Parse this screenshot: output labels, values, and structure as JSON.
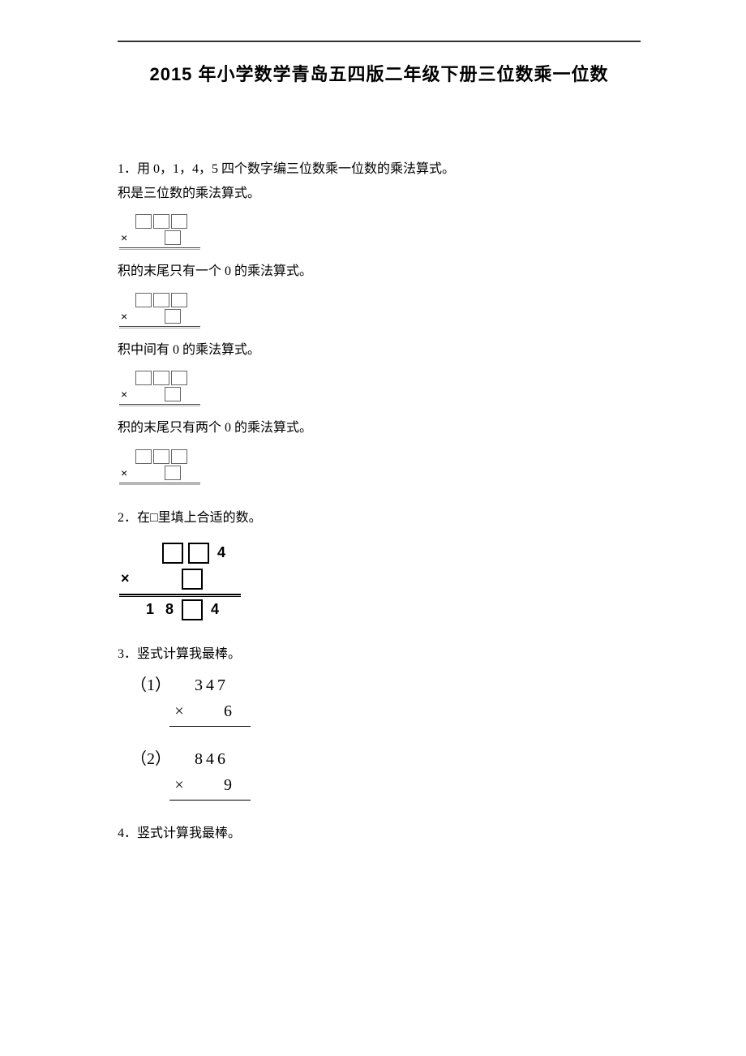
{
  "title": "2015 年小学数学青岛五四版二年级下册三位数乘一位数",
  "q1": {
    "number": "1．",
    "prompt": "用 0，1，4，5 四个数字编三位数乘一位数的乘法算式。",
    "sub1": "积是三位数的乘法算式。",
    "sub2": "积的末尾只有一个 0 的乘法算式。",
    "sub3": "积中间有 0 的乘法算式。",
    "sub4": "积的末尾只有两个 0 的乘法算式。"
  },
  "q2": {
    "number": "2．",
    "prompt": "在□里填上合适的数。",
    "top_trailing": "4",
    "times": "×",
    "result_a": "1",
    "result_b": "8",
    "result_d": "4"
  },
  "q3": {
    "number": "3．",
    "prompt": "竖式计算我最棒。",
    "items": [
      {
        "label": "（1）",
        "multiplicand": "347",
        "multiplier": "6"
      },
      {
        "label": "（2）",
        "multiplicand": "846",
        "multiplier": "9"
      }
    ],
    "times": "×"
  },
  "q4": {
    "number": "4．",
    "prompt": "竖式计算我最棒。"
  }
}
